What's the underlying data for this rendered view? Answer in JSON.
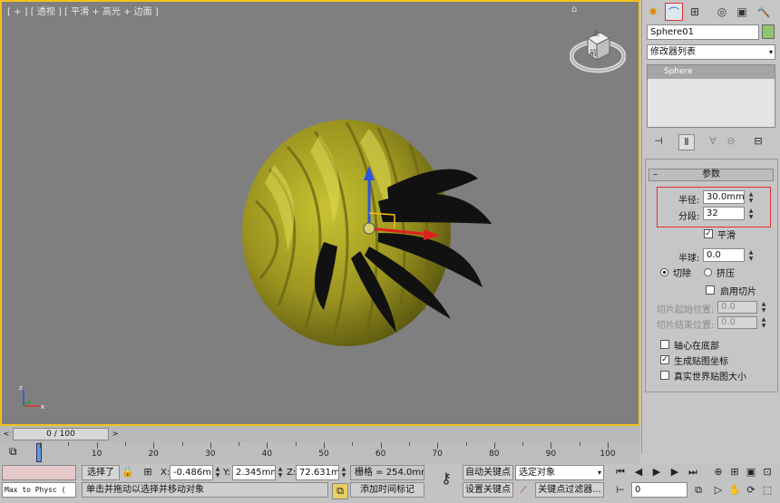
{
  "viewport": {
    "label": "[ + ] [ 透视 ] [ 平滑 + 高光 + 边面 ]",
    "viewcube_top": "上",
    "viewcube_front": "前"
  },
  "command_panel": {
    "object_name": "Sphere01",
    "object_color": "#8fc46e",
    "modifier_list": "修改器列表",
    "stack_item": "Sphere",
    "rollout_title": "参数",
    "radius_label": "半径:",
    "radius_value": "30.0mm",
    "segments_label": "分段:",
    "segments_value": "32",
    "smooth_label": "平滑",
    "smooth_checked": true,
    "hemisphere_label": "半球:",
    "hemisphere_value": "0.0",
    "chop_label": "切除",
    "squash_label": "挤压",
    "slice_on_label": "启用切片",
    "slice_from_label": "切片起始位置:",
    "slice_from_value": "0.0",
    "slice_to_label": "切片结束位置:",
    "slice_to_value": "0.0",
    "base_to_pivot_label": "轴心在底部",
    "gen_map_coords_label": "生成贴图坐标",
    "gen_map_coords_checked": true,
    "real_world_label": "真实世界贴图大小"
  },
  "timeline": {
    "frame_display": "0 / 100",
    "ticks": [
      "10",
      "20",
      "30",
      "40",
      "50",
      "60",
      "70",
      "80",
      "90",
      "100"
    ]
  },
  "status": {
    "script_listener": "Max to Physc (",
    "selection_label": "选择了",
    "x_label": "X:",
    "x_value": "-0.486mm",
    "y_label": "Y:",
    "y_value": "2.345mm",
    "z_label": "Z:",
    "z_value": "72.631mm",
    "grid_label": "栅格 = 254.0mm",
    "prompt": "单击并拖动以选择并移动对象",
    "add_time_tag": "添加时间标记",
    "auto_key": "自动关键点",
    "set_key": "设置关键点",
    "selected_object": "选定对象",
    "key_filters": "关键点过滤器...",
    "current_frame": "0"
  },
  "colors": {
    "viewport_border": "#f2c21b",
    "object_color": "#8fc46e",
    "highlight_red": "#e03030"
  }
}
